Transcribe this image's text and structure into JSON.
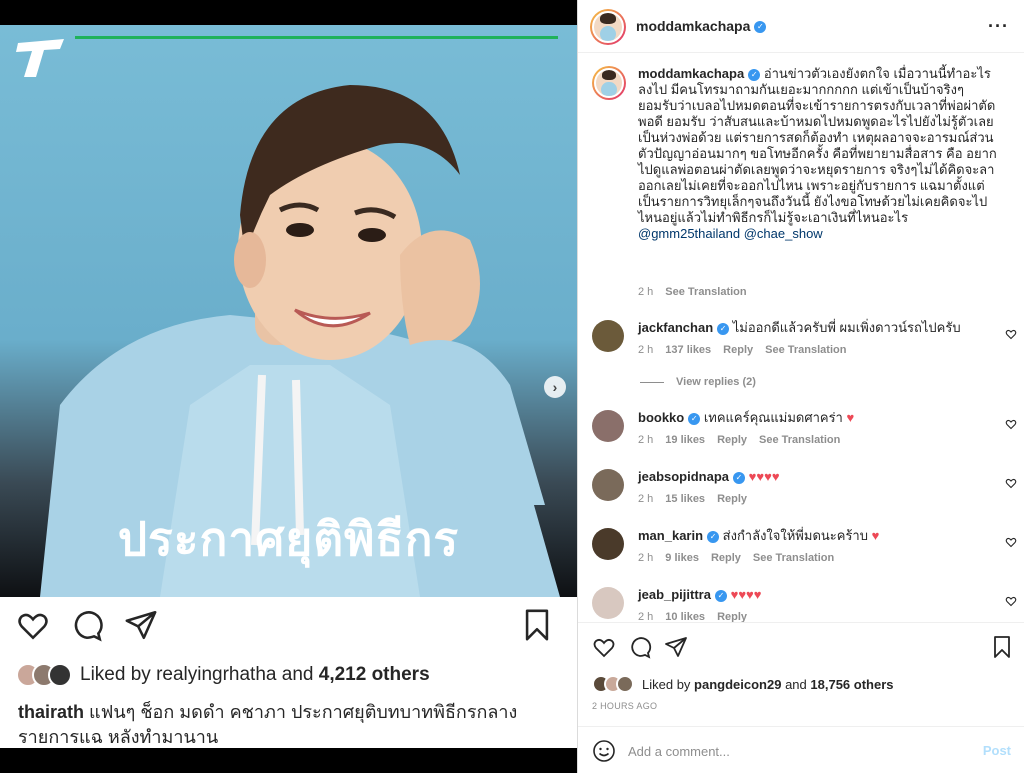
{
  "photo": {
    "headline": "ประกาศยุติพิธีกร"
  },
  "left_post": {
    "likes": {
      "prefix": "Liked by ",
      "user": "realyingrhatha",
      "middle": " and ",
      "count": "4,212 others"
    },
    "caption": {
      "user": "thairath",
      "text": " แฟนๆ ช็อก มดดำ คชาภา ประกาศยุติบทบาทพิธีกรกลางรายการแฉ หลังทำมานาน"
    }
  },
  "right_post": {
    "header": {
      "username": "moddamkachapa"
    },
    "main_caption": {
      "username": "moddamkachapa",
      "text": " อ่านข่าวตัวเองยังตกใจ เมื่อวานนี้ทำอะไรลงไป มีคนโทรมาถามกันเยอะมากกกกก แต่เข้าเป็นบ้าจริงๆยอมรับว่าเบลอไปหมดตอนที่จะเข้ารายการตรงกับเวลาที่พ่อผ่าตัดพอดี ยอมรับ ว่าสับสนและบ้าหมดไปหมดพูดอะไรไปยังไม่รู้ตัวเลยเป็นห่วงพ่อด้วย แต่รายการสดก็ต้องทำ เหตุผลอาจจะอารมณ์ส่วนตัวปัญญาอ่อนมากๆ ขอโทษอีกครั้ง คือที่พยายามสื่อสาร คือ อยากไปดูแลพ่อตอนผ่าตัดเลยพูดว่าจะหยุดรายการ จริงๆไม่ได้คิดจะลาออกเลยไม่เคยที่จะออกไปไหน เพราะอยู่กับรายการ แฉมาตั้งแต่เป็นรายการวิทยุเล็กๆจนถึงวันนี้ ยังไงขอโทษด้วยไม่เคยคิดจะไปไหนอยู่แล้วไม่ทำพิธีกรก็ไม่รู้จะเอาเงินที่ไหนอะไร ",
      "mention1": "@gmm25thailand",
      "mention2": "@chae_show",
      "time": "2 h",
      "see_translation": "See Translation"
    },
    "comments": [
      {
        "user": "jackfanchan",
        "text": " ไม่ออกดีแล้วครับพี่ ผมเพิ่งดาวน์รถไปครับ",
        "time": "2 h",
        "likes": "137 likes",
        "reply": "Reply",
        "translate": "See Translation",
        "av_color": "#6b5a3a"
      },
      {
        "user": "bookko",
        "text": " เทคแคร์คุณแม่มดศาคร่า ",
        "hearts": "♥",
        "time": "2 h",
        "likes": "19 likes",
        "reply": "Reply",
        "translate": "See Translation",
        "av_color": "#8a6f6a"
      },
      {
        "user": "jeabsopidnapa",
        "text": " ",
        "hearts": "♥♥♥♥",
        "time": "2 h",
        "likes": "15 likes",
        "reply": "Reply",
        "av_color": "#7a6a5a"
      },
      {
        "user": "man_karin",
        "text": " ส่งกำลังใจให้พี่มดนะคร้าบ ",
        "hearts": "♥",
        "time": "2 h",
        "likes": "9 likes",
        "reply": "Reply",
        "translate": "See Translation",
        "av_color": "#4a3a2a"
      },
      {
        "user": "jeab_pijittra",
        "text": " ",
        "hearts": "♥♥♥♥",
        "time": "2 h",
        "likes": "10 likes",
        "reply": "Reply",
        "av_color": "#d8c8c0"
      }
    ],
    "view_replies": "View replies (2)",
    "likes": {
      "prefix": "Liked by ",
      "user": "pangdeicon29",
      "middle": " and ",
      "count": "18,756 others"
    },
    "date": "2 HOURS AGO",
    "add_comment_placeholder": "Add a comment...",
    "post_label": "Post"
  },
  "colors": {
    "verified": "#3897f0",
    "link": "#00376b",
    "heart": "#ed4956",
    "post_disabled": "#b2dffc",
    "green_bar": "#1fb25a"
  }
}
